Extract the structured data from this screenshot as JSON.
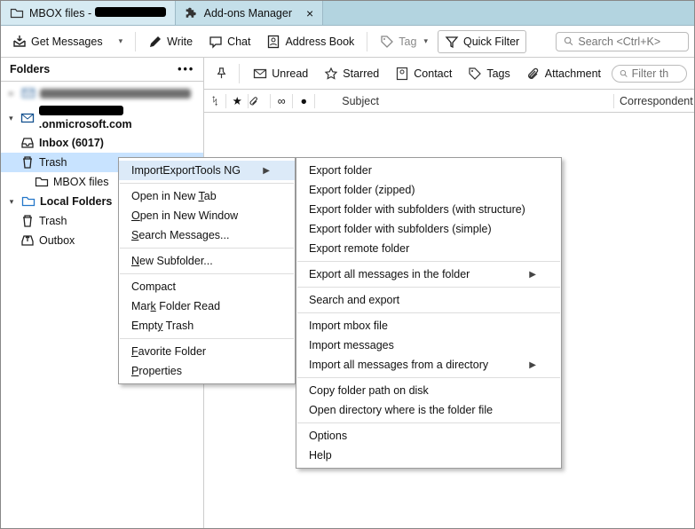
{
  "tabs": {
    "t1_prefix": "MBOX files - ",
    "t2": "Add-ons Manager"
  },
  "toolbar": {
    "getmsg": "Get Messages",
    "write": "Write",
    "chat": "Chat",
    "address": "Address Book",
    "tag": "Tag",
    "quickfilter": "Quick Filter",
    "search_ph": "Search <Ctrl+K>"
  },
  "sidebar": {
    "title": "Folders",
    "acct2_suffix": ".onmicrosoft.com",
    "inbox": "Inbox (6017)",
    "trash": "Trash",
    "mbox": "MBOX files",
    "local": "Local Folders",
    "ltrash": "Trash",
    "outbox": "Outbox"
  },
  "filter": {
    "unread": "Unread",
    "starred": "Starred",
    "contact": "Contact",
    "tags": "Tags",
    "attachment": "Attachment",
    "filter_ph": "Filter th"
  },
  "cols": {
    "subject": "Subject",
    "correspondent": "Correspondent"
  },
  "ctx1": {
    "importexport": "ImportExportTools NG",
    "opentab_pre": "Open in New ",
    "opentab_u": "T",
    "opentab_post": "ab",
    "openwin_u": "O",
    "openwin_post": "pen in New Window",
    "search_u": "S",
    "search_post": "earch Messages...",
    "newsub_u": "N",
    "newsub_post": "ew Subfolder...",
    "compact": "Compact",
    "markread_pre": "Mar",
    "markread_u": "k",
    "markread_post": " Folder Read",
    "empty_pre": "Empt",
    "empty_u": "y",
    "empty_post": " Trash",
    "fav_u": "F",
    "fav_post": "avorite Folder",
    "props_u": "P",
    "props_post": "roperties"
  },
  "ctx2": {
    "exportfolder": "Export folder",
    "exportzip": "Export folder (zipped)",
    "exportstruct": "Export folder with subfolders (with structure)",
    "exportsimple": "Export folder with subfolders (simple)",
    "exportremote": "Export remote folder",
    "exportall": "Export all messages in the folder",
    "searchexport": "Search and export",
    "importmbox": "Import mbox file",
    "importmsg": "Import messages",
    "importall": "Import all messages from a directory",
    "copypath": "Copy folder path on disk",
    "opendir": "Open directory where is the folder file",
    "options": "Options",
    "help": "Help"
  }
}
